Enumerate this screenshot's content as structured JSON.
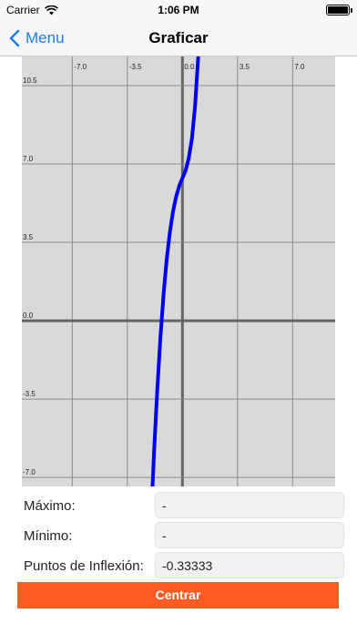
{
  "status_bar": {
    "carrier": "Carrier",
    "time": "1:06 PM"
  },
  "nav": {
    "back_label": "Menu",
    "title": "Graficar"
  },
  "colors": {
    "accent_blue": "#1a7cf5",
    "curve": "#0000ee",
    "button": "#fd5b24",
    "graph_background": "#d9d9d9"
  },
  "chart_data": {
    "type": "line",
    "title": "",
    "xlabel": "",
    "ylabel": "",
    "xlim": [
      -10.2,
      9.7
    ],
    "ylim": [
      -7.4,
      11.8
    ],
    "x_ticks": [
      -7.0,
      -3.5,
      0.0,
      3.5,
      7.0
    ],
    "x_tick_labels": [
      "-7.0",
      "-3.5",
      "0.0",
      "3.5",
      "7.0"
    ],
    "y_ticks": [
      10.5,
      7.0,
      3.5,
      0.0,
      -3.5,
      -7.0
    ],
    "y_tick_labels": [
      "10.5",
      "7.0",
      "3.5",
      "0.0",
      "-3.5",
      "-7.0"
    ],
    "grid": true,
    "series": [
      {
        "points": [
          [
            -1.9,
            -7.4
          ],
          [
            -1.8,
            -5.83
          ],
          [
            -1.6,
            -3.1
          ],
          [
            -1.4,
            -0.77
          ],
          [
            -1.2,
            1.17
          ],
          [
            -1.0,
            2.72
          ],
          [
            -0.8,
            3.94
          ],
          [
            -0.6,
            4.86
          ],
          [
            -0.4,
            5.54
          ],
          [
            -0.2,
            6.03
          ],
          [
            0.0,
            6.37
          ],
          [
            0.2,
            6.7
          ],
          [
            0.4,
            7.25
          ],
          [
            0.6,
            8.11
          ],
          [
            0.8,
            9.58
          ],
          [
            1.0,
            11.76
          ]
        ]
      }
    ]
  },
  "form": {
    "maximo_label": "Máximo:",
    "maximo_value": "-",
    "minimo_label": "Mínimo:",
    "minimo_value": "-",
    "inflexion_label": "Puntos de Inflexión:",
    "inflexion_value": "-0.33333"
  },
  "centrar_button": "Centrar"
}
